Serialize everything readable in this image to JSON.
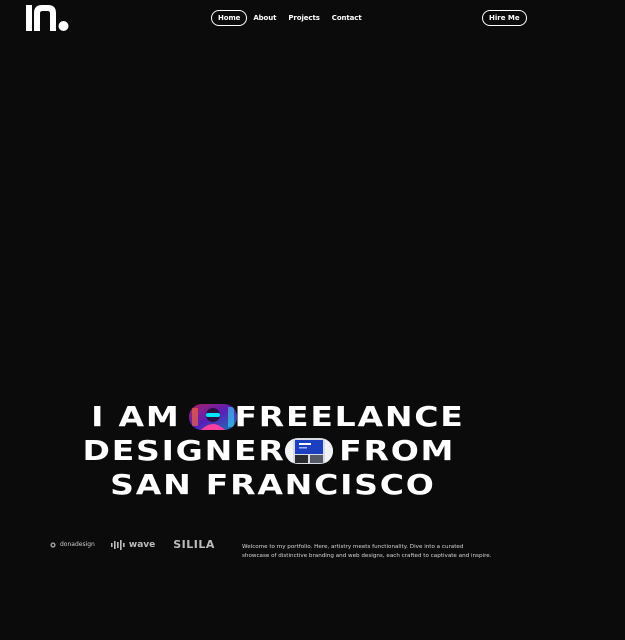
{
  "header": {
    "logo_name": "portfolio-logo",
    "nav": [
      {
        "label": "Home",
        "active": true
      },
      {
        "label": "About",
        "active": false
      },
      {
        "label": "Projects",
        "active": false
      },
      {
        "label": "Contact",
        "active": false
      }
    ],
    "hire_label": "Hire Me"
  },
  "hero": {
    "line1": {
      "before": "I AM",
      "after": "FREELANCE"
    },
    "line2": {
      "before": "DESIGNER",
      "after": "FROM"
    },
    "line3": {
      "text": "SAN FRANCISCO"
    }
  },
  "brands": {
    "dona": "donadesign",
    "wave": "wave",
    "silila": "SILILA"
  },
  "intro": "Welcome to my portfolio. Here, artistry meets functionality. Dive into a curated showcase of distinctive branding and web designs, each crafted to captivate and inspire.",
  "colors": {
    "background": "#0b0b0b",
    "text": "#ffffff",
    "muted": "#bdbdbd"
  }
}
